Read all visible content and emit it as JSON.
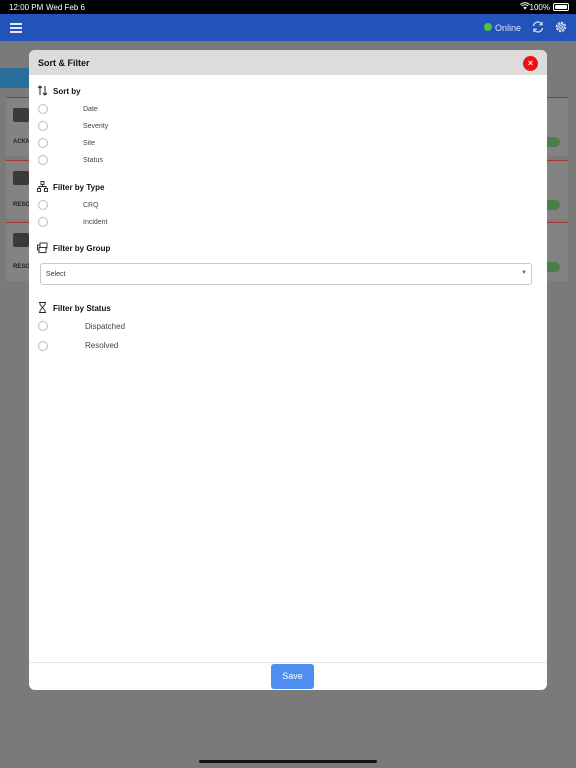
{
  "status_bar": {
    "time": "12:00 PM",
    "date": "Wed Feb 6",
    "battery": "100%"
  },
  "app_bar": {
    "online_label": "Online"
  },
  "background_cards": [
    {
      "code": "ACKN"
    },
    {
      "code": "RESO"
    },
    {
      "code": "RESO"
    }
  ],
  "modal": {
    "title": "Sort & Filter",
    "close_label": "×",
    "sort_by": {
      "title": "Sort by",
      "options": [
        "Date",
        "Severity",
        "Site",
        "Status"
      ]
    },
    "filter_type": {
      "title": "Filter by Type",
      "options": [
        "CRQ",
        "Incident"
      ]
    },
    "filter_group": {
      "title": "Filter by Group",
      "select_value": "Select"
    },
    "filter_status": {
      "title": "Filter by Status",
      "options": [
        "Dispatched",
        "Resolved"
      ]
    },
    "save_label": "Save"
  },
  "colors": {
    "app_bar": "#2253b8",
    "online": "#55c043",
    "close": "#ee1111",
    "save": "#4d8ef0"
  }
}
